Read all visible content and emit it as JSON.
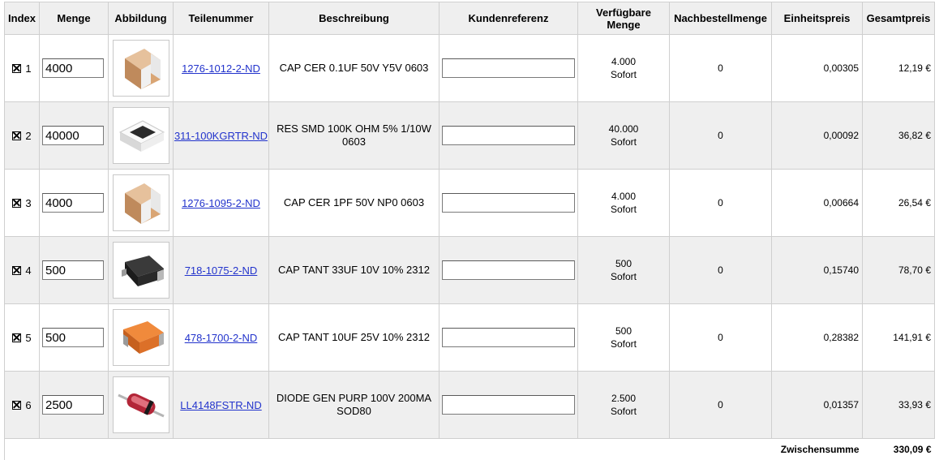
{
  "headers": {
    "index": "Index",
    "quantity": "Menge",
    "image": "Abbildung",
    "part_number": "Teilenummer",
    "description": "Beschreibung",
    "customer_ref": "Kundenreferenz",
    "available_line1": "Verfügbare",
    "available_line2": "Menge",
    "backorder": "Nachbestellmenge",
    "unit_price": "Einheitspreis",
    "total_price": "Gesamtpreis"
  },
  "rows": [
    {
      "index": "1",
      "quantity": "4000",
      "image_icon": "ceramic-capacitor-icon",
      "part_number": "1276-1012-2-ND",
      "description": "CAP CER 0.1UF 50V Y5V 0603",
      "customer_ref": "",
      "available_qty": "4.000",
      "available_status": "Sofort",
      "backorder": "0",
      "unit_price": "0,00305",
      "total_price": "12,19 €"
    },
    {
      "index": "2",
      "quantity": "40000",
      "image_icon": "smd-resistor-icon",
      "part_number": "311-100KGRTR-ND",
      "description": "RES SMD 100K OHM 5% 1/10W 0603",
      "customer_ref": "",
      "available_qty": "40.000",
      "available_status": "Sofort",
      "backorder": "0",
      "unit_price": "0,00092",
      "total_price": "36,82 €"
    },
    {
      "index": "3",
      "quantity": "4000",
      "image_icon": "ceramic-capacitor-icon",
      "part_number": "1276-1095-2-ND",
      "description": "CAP CER 1PF 50V NP0 0603",
      "customer_ref": "",
      "available_qty": "4.000",
      "available_status": "Sofort",
      "backorder": "0",
      "unit_price": "0,00664",
      "total_price": "26,54 €"
    },
    {
      "index": "4",
      "quantity": "500",
      "image_icon": "tantalum-capacitor-black-icon",
      "part_number": "718-1075-2-ND",
      "description": "CAP TANT 33UF 10V 10% 2312",
      "customer_ref": "",
      "available_qty": "500",
      "available_status": "Sofort",
      "backorder": "0",
      "unit_price": "0,15740",
      "total_price": "78,70 €"
    },
    {
      "index": "5",
      "quantity": "500",
      "image_icon": "tantalum-capacitor-orange-icon",
      "part_number": "478-1700-2-ND",
      "description": "CAP TANT 10UF 25V 10% 2312",
      "customer_ref": "",
      "available_qty": "500",
      "available_status": "Sofort",
      "backorder": "0",
      "unit_price": "0,28382",
      "total_price": "141,91 €"
    },
    {
      "index": "6",
      "quantity": "2500",
      "image_icon": "sod80-diode-icon",
      "part_number": "LL4148FSTR-ND",
      "description": "DIODE GEN PURP 100V 200MA SOD80",
      "customer_ref": "",
      "available_qty": "2.500",
      "available_status": "Sofort",
      "backorder": "0",
      "unit_price": "0,01357",
      "total_price": "33,93 €"
    }
  ],
  "subtotal": {
    "label": "Zwischensumme",
    "value": "330,09 €"
  }
}
